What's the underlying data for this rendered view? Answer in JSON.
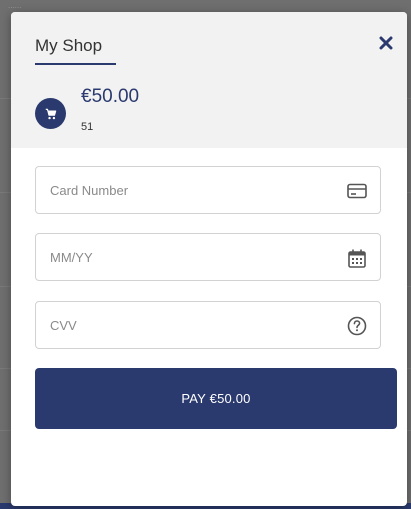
{
  "backdrop": {
    "corner_text": "......"
  },
  "header": {
    "shop_name": "My Shop",
    "amount": "€50.00",
    "order_reference": "51",
    "close_icon": "close-icon",
    "cart_icon": "cart-icon"
  },
  "form": {
    "card_number": {
      "placeholder": "Card Number",
      "value": "",
      "icon": "credit-card-icon"
    },
    "expiry": {
      "placeholder": "MM/YY",
      "value": "",
      "icon": "calendar-icon"
    },
    "cvv": {
      "placeholder": "CVV",
      "value": "",
      "icon": "help-circle-icon"
    },
    "pay_label": "PAY €50.00"
  },
  "colors": {
    "brand": "#2a3a6e",
    "header_bg": "#f2f2f2",
    "field_border": "#d2d2d2",
    "backdrop": "#6f6f6f"
  }
}
